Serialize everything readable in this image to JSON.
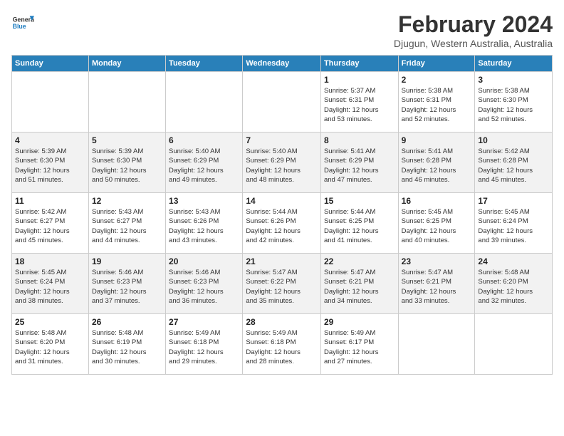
{
  "header": {
    "logo_general": "General",
    "logo_blue": "Blue",
    "title": "February 2024",
    "subtitle": "Djugun, Western Australia, Australia"
  },
  "days_of_week": [
    "Sunday",
    "Monday",
    "Tuesday",
    "Wednesday",
    "Thursday",
    "Friday",
    "Saturday"
  ],
  "weeks": [
    [
      {
        "day": "",
        "info": ""
      },
      {
        "day": "",
        "info": ""
      },
      {
        "day": "",
        "info": ""
      },
      {
        "day": "",
        "info": ""
      },
      {
        "day": "1",
        "info": "Sunrise: 5:37 AM\nSunset: 6:31 PM\nDaylight: 12 hours\nand 53 minutes."
      },
      {
        "day": "2",
        "info": "Sunrise: 5:38 AM\nSunset: 6:31 PM\nDaylight: 12 hours\nand 52 minutes."
      },
      {
        "day": "3",
        "info": "Sunrise: 5:38 AM\nSunset: 6:30 PM\nDaylight: 12 hours\nand 52 minutes."
      }
    ],
    [
      {
        "day": "4",
        "info": "Sunrise: 5:39 AM\nSunset: 6:30 PM\nDaylight: 12 hours\nand 51 minutes."
      },
      {
        "day": "5",
        "info": "Sunrise: 5:39 AM\nSunset: 6:30 PM\nDaylight: 12 hours\nand 50 minutes."
      },
      {
        "day": "6",
        "info": "Sunrise: 5:40 AM\nSunset: 6:29 PM\nDaylight: 12 hours\nand 49 minutes."
      },
      {
        "day": "7",
        "info": "Sunrise: 5:40 AM\nSunset: 6:29 PM\nDaylight: 12 hours\nand 48 minutes."
      },
      {
        "day": "8",
        "info": "Sunrise: 5:41 AM\nSunset: 6:29 PM\nDaylight: 12 hours\nand 47 minutes."
      },
      {
        "day": "9",
        "info": "Sunrise: 5:41 AM\nSunset: 6:28 PM\nDaylight: 12 hours\nand 46 minutes."
      },
      {
        "day": "10",
        "info": "Sunrise: 5:42 AM\nSunset: 6:28 PM\nDaylight: 12 hours\nand 45 minutes."
      }
    ],
    [
      {
        "day": "11",
        "info": "Sunrise: 5:42 AM\nSunset: 6:27 PM\nDaylight: 12 hours\nand 45 minutes."
      },
      {
        "day": "12",
        "info": "Sunrise: 5:43 AM\nSunset: 6:27 PM\nDaylight: 12 hours\nand 44 minutes."
      },
      {
        "day": "13",
        "info": "Sunrise: 5:43 AM\nSunset: 6:26 PM\nDaylight: 12 hours\nand 43 minutes."
      },
      {
        "day": "14",
        "info": "Sunrise: 5:44 AM\nSunset: 6:26 PM\nDaylight: 12 hours\nand 42 minutes."
      },
      {
        "day": "15",
        "info": "Sunrise: 5:44 AM\nSunset: 6:25 PM\nDaylight: 12 hours\nand 41 minutes."
      },
      {
        "day": "16",
        "info": "Sunrise: 5:45 AM\nSunset: 6:25 PM\nDaylight: 12 hours\nand 40 minutes."
      },
      {
        "day": "17",
        "info": "Sunrise: 5:45 AM\nSunset: 6:24 PM\nDaylight: 12 hours\nand 39 minutes."
      }
    ],
    [
      {
        "day": "18",
        "info": "Sunrise: 5:45 AM\nSunset: 6:24 PM\nDaylight: 12 hours\nand 38 minutes."
      },
      {
        "day": "19",
        "info": "Sunrise: 5:46 AM\nSunset: 6:23 PM\nDaylight: 12 hours\nand 37 minutes."
      },
      {
        "day": "20",
        "info": "Sunrise: 5:46 AM\nSunset: 6:23 PM\nDaylight: 12 hours\nand 36 minutes."
      },
      {
        "day": "21",
        "info": "Sunrise: 5:47 AM\nSunset: 6:22 PM\nDaylight: 12 hours\nand 35 minutes."
      },
      {
        "day": "22",
        "info": "Sunrise: 5:47 AM\nSunset: 6:21 PM\nDaylight: 12 hours\nand 34 minutes."
      },
      {
        "day": "23",
        "info": "Sunrise: 5:47 AM\nSunset: 6:21 PM\nDaylight: 12 hours\nand 33 minutes."
      },
      {
        "day": "24",
        "info": "Sunrise: 5:48 AM\nSunset: 6:20 PM\nDaylight: 12 hours\nand 32 minutes."
      }
    ],
    [
      {
        "day": "25",
        "info": "Sunrise: 5:48 AM\nSunset: 6:20 PM\nDaylight: 12 hours\nand 31 minutes."
      },
      {
        "day": "26",
        "info": "Sunrise: 5:48 AM\nSunset: 6:19 PM\nDaylight: 12 hours\nand 30 minutes."
      },
      {
        "day": "27",
        "info": "Sunrise: 5:49 AM\nSunset: 6:18 PM\nDaylight: 12 hours\nand 29 minutes."
      },
      {
        "day": "28",
        "info": "Sunrise: 5:49 AM\nSunset: 6:18 PM\nDaylight: 12 hours\nand 28 minutes."
      },
      {
        "day": "29",
        "info": "Sunrise: 5:49 AM\nSunset: 6:17 PM\nDaylight: 12 hours\nand 27 minutes."
      },
      {
        "day": "",
        "info": ""
      },
      {
        "day": "",
        "info": ""
      }
    ]
  ]
}
